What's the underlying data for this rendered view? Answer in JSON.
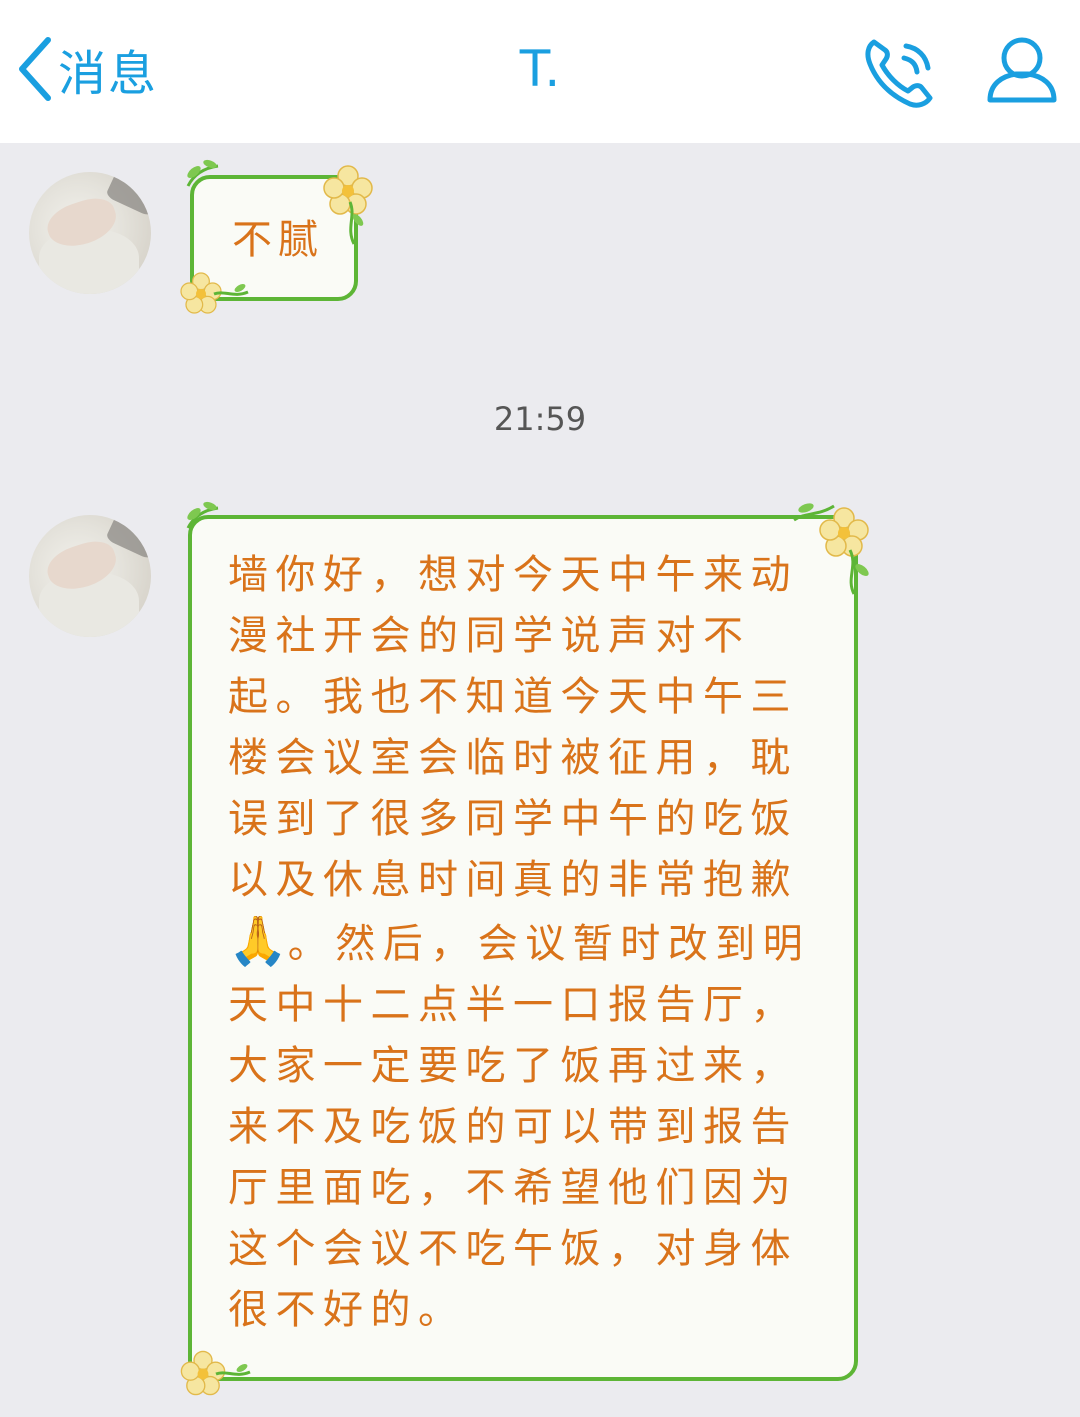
{
  "header": {
    "back_label": "消息",
    "title": "T.",
    "accent_color": "#1a9fe0",
    "icons": [
      "chevron-left-icon",
      "phone-icon",
      "contact-icon"
    ]
  },
  "messages": [
    {
      "sender": "T.",
      "text": "不腻"
    },
    {
      "sender": "T.",
      "text": "墙你好，想对今天中午来动漫社开会的同学说声对不起。我也不知道今天中午三楼会议室会临时被征用，耽误到了很多同学中午的吃饭以及休息时间真的非常抱歉",
      "emoji": "🙏",
      "text_after": "。然后，会议暂时改到明天中十二点半一口报告厅，大家一定要吃了饭再过来，来不及吃饭的可以带到报告厅里面吃，不希望他们因为这个会议不吃午饭，对身体很不好的。"
    }
  ],
  "timestamp": "21:59",
  "colors": {
    "bubble_border": "#5db536",
    "bubble_text": "#d9731a",
    "background": "#ebebef"
  }
}
